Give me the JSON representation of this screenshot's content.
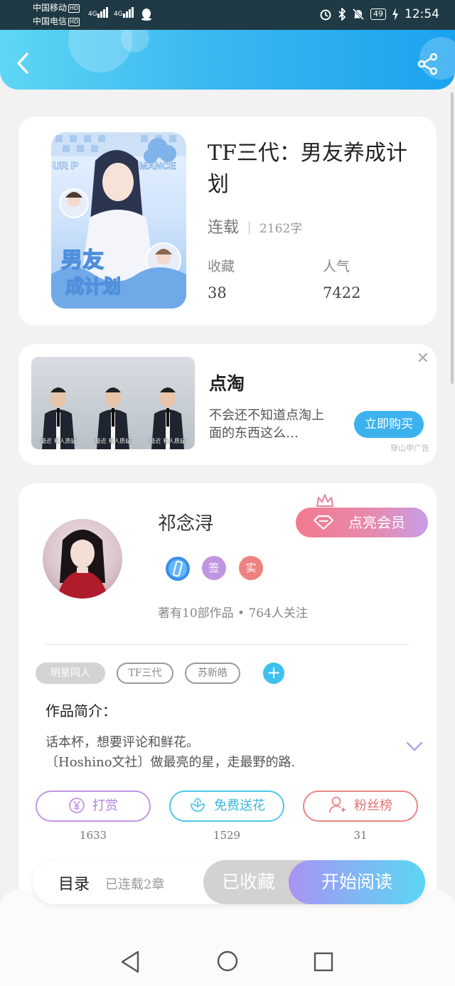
{
  "status_bar": {
    "carrier1": "中国移动",
    "carrier2": "中国电信",
    "hd_badge": "HD",
    "network": "4G",
    "battery": "49",
    "time": "12:54"
  },
  "header": {
    "back_icon": "chevron-left-icon",
    "share_icon": "share-icon",
    "bg_color": "#2eb0ef"
  },
  "book": {
    "title": "TF三代：男友养成计划",
    "status": "连载",
    "word_count": "2162字",
    "favorites_label": "收藏",
    "favorites_value": "38",
    "popularity_label": "人气",
    "popularity_value": "7422"
  },
  "ad": {
    "title": "点淘",
    "description": "不会还不知道点淘上面的东西这么…",
    "button": "立即购买",
    "source": "穿山甲广告",
    "caption": "最近 有人质疑",
    "close_icon": "close-icon"
  },
  "author": {
    "name": "祁念浔",
    "vip_button": "点亮会员",
    "badges": [
      "签",
      "实"
    ],
    "meta": "著有10部作品 • 764人关注",
    "tags": [
      "明星同人",
      "TF三代",
      "苏新皓"
    ],
    "intro_heading": "作品简介：",
    "intro_lines": [
      "话本杯，想要评论和鲜花。",
      "〔Hoshino文社〕做最亮的星，走最野的路."
    ],
    "actions": [
      {
        "label": "打赏",
        "count": "1633",
        "icon": "yen-icon",
        "color": "#c396e3"
      },
      {
        "label": "免费送花",
        "count": "1529",
        "icon": "flower-icon",
        "color": "#4cc8ea"
      },
      {
        "label": "粉丝榜",
        "count": "31",
        "icon": "user-icon",
        "color": "#e98585"
      }
    ]
  },
  "bottom_bar": {
    "toc_label": "目录",
    "toc_sub": "已连载2章",
    "collected": "已收藏",
    "read": "开始阅读"
  },
  "nav_bar": {
    "back_icon": "triangle-back-icon",
    "home_icon": "circle-home-icon",
    "recent_icon": "square-recent-icon"
  }
}
